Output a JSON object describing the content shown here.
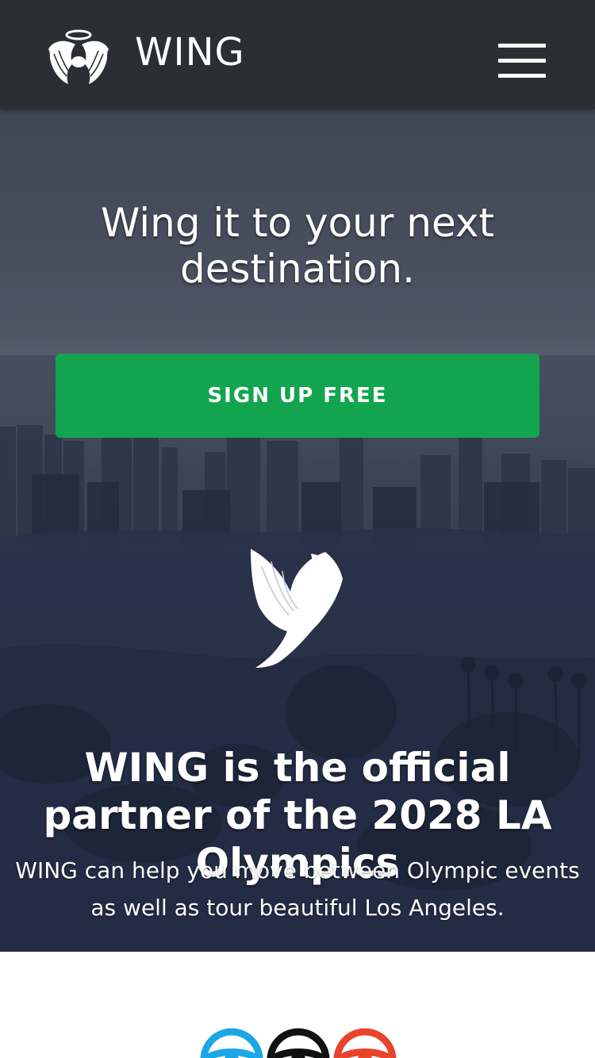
{
  "header": {
    "brand_name": "WING",
    "logo_icon": "winged-halo-icon",
    "menu_icon": "hamburger-menu-icon"
  },
  "hero": {
    "title": "Wing it to your next destination.",
    "cta_label": "SIGN UP FREE",
    "emblem_icon": "winged-figure-icon",
    "partner_heading": "WING is the official partner of the 2028 LA Olympics",
    "partner_text": "WING can help you move between Olympic events as well as tour beautiful Los Angeles."
  },
  "features": {
    "icons": [
      {
        "name": "steering-wheel-blue-icon",
        "color": "#1ba7e6"
      },
      {
        "name": "steering-wheel-black-icon",
        "color": "#111111"
      },
      {
        "name": "steering-wheel-red-icon",
        "color": "#e8442d"
      }
    ]
  },
  "colors": {
    "navbar": "#2b2e33",
    "cta": "#13a44f",
    "hero_overlay": "#2a3350"
  }
}
